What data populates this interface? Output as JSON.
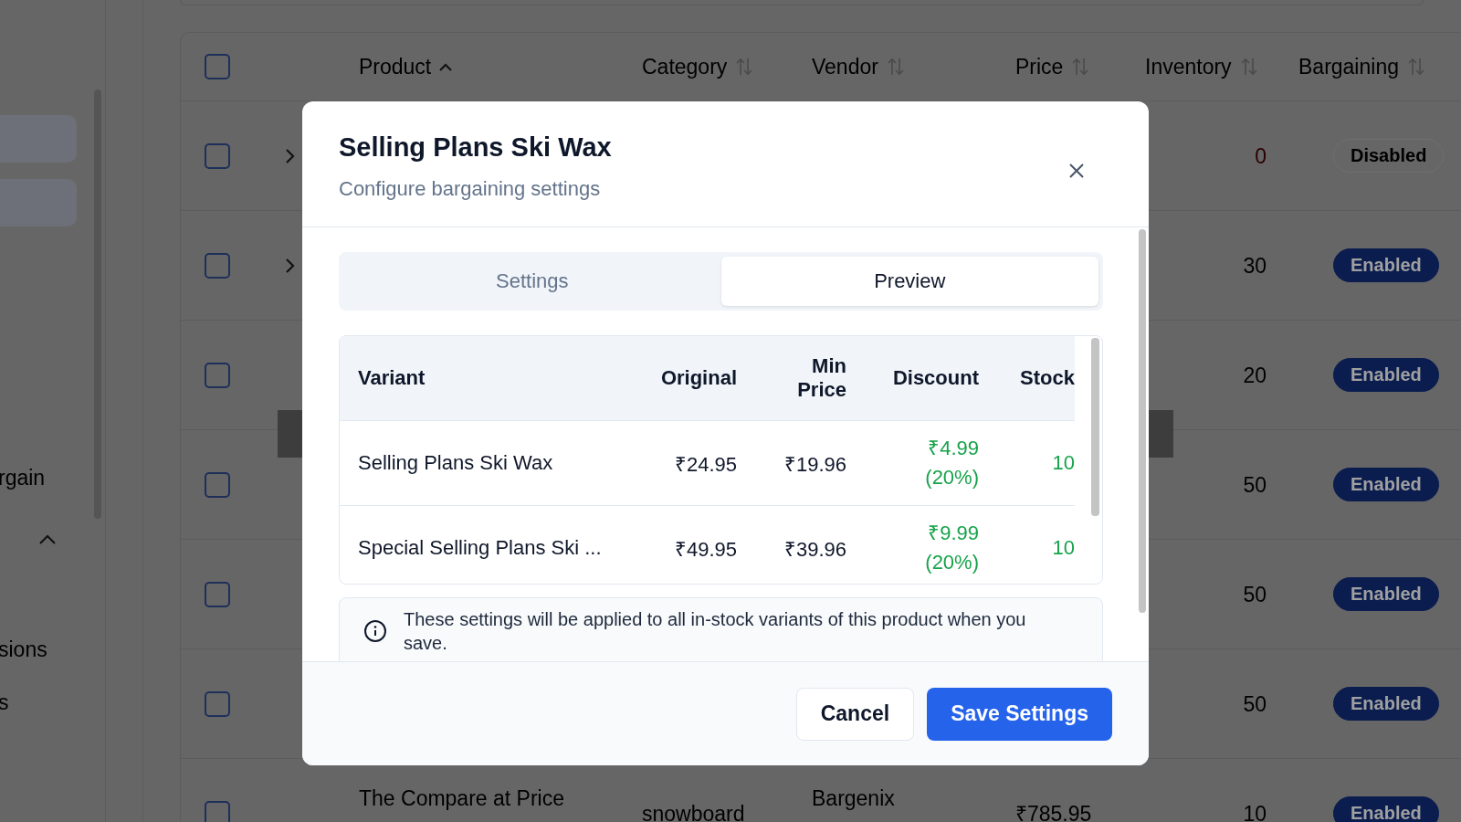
{
  "sidebar": {
    "items": [
      {
        "label": "rgain"
      },
      {
        "label": "sions"
      },
      {
        "label": "s"
      }
    ],
    "section_toggle": {
      "expanded": true
    }
  },
  "table": {
    "header_checkbox": {
      "checked": false
    },
    "columns": [
      {
        "label": "Product",
        "sorted": true
      },
      {
        "label": "Category",
        "sorted": false
      },
      {
        "label": "Vendor",
        "sorted": false
      },
      {
        "label": "Price",
        "sorted": false
      },
      {
        "label": "Inventory",
        "sorted": false
      },
      {
        "label": "Bargaining",
        "sorted": false
      }
    ],
    "rows": [
      {
        "checked": false,
        "expandable": true,
        "inventory": "0",
        "low_stock": true,
        "bargaining": {
          "label": "Disabled",
          "on": false
        }
      },
      {
        "checked": false,
        "expandable": true,
        "inventory": "30",
        "low_stock": false,
        "bargaining": {
          "label": "Enabled",
          "on": true
        }
      },
      {
        "checked": false,
        "expandable": false,
        "inventory": "20",
        "low_stock": false,
        "bargaining": {
          "label": "Enabled",
          "on": true
        }
      },
      {
        "checked": false,
        "expandable": false,
        "inventory": "50",
        "low_stock": false,
        "bargaining": {
          "label": "Enabled",
          "on": true
        }
      },
      {
        "checked": false,
        "expandable": false,
        "inventory": "50",
        "low_stock": false,
        "bargaining": {
          "label": "Enabled",
          "on": true
        }
      },
      {
        "checked": false,
        "expandable": false,
        "inventory": "50",
        "low_stock": false,
        "bargaining": {
          "label": "Enabled",
          "on": true
        }
      },
      {
        "checked": false,
        "expandable": false,
        "product": "The Compare at Price",
        "category": "snowboard",
        "vendor": "Bargenix",
        "price": "₹785.95",
        "inventory": "10",
        "low_stock": false,
        "bargaining": {
          "label": "Enabled",
          "on": true
        }
      }
    ]
  },
  "modal": {
    "title": "Selling Plans Ski Wax",
    "subtitle": "Configure bargaining settings",
    "tabs": [
      {
        "label": "Settings",
        "selected": false
      },
      {
        "label": "Preview",
        "selected": true
      }
    ],
    "preview_table": {
      "columns": [
        "Variant",
        "Original",
        "Min Price",
        "Discount",
        "Stock"
      ],
      "rows": [
        {
          "variant": "Selling Plans Ski Wax",
          "original": "₹24.95",
          "min_price": "₹19.96",
          "discount": "₹4.99 (20%)",
          "stock": "10"
        },
        {
          "variant": "Special Selling Plans Ski ...",
          "original": "₹49.95",
          "min_price": "₹39.96",
          "discount": "₹9.99 (20%)",
          "stock": "10"
        }
      ]
    },
    "note": "These settings will be applied to all in-stock variants of this product when you save.",
    "buttons": {
      "cancel": "Cancel",
      "save": "Save Settings"
    }
  }
}
